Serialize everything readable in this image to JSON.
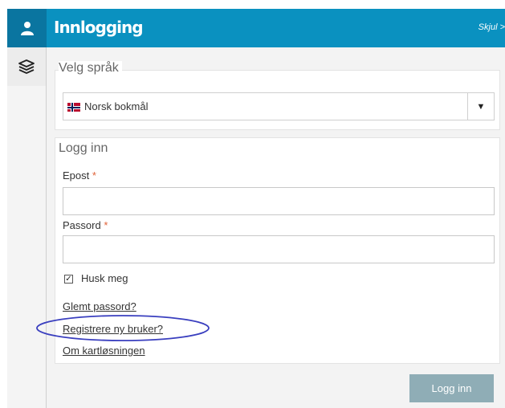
{
  "sidebar": {
    "user_icon": "user-icon",
    "layers_icon": "layers-icon"
  },
  "header": {
    "title": "Innlogging",
    "hide_label": "Skjul >"
  },
  "language": {
    "legend": "Velg språk",
    "selected": "Norsk bokmål",
    "arrow": "▼"
  },
  "login": {
    "legend": "Logg inn",
    "email_label": "Epost",
    "email_value": "",
    "password_label": "Passord",
    "password_value": "",
    "required_mark": "*",
    "remember_label": "Husk meg",
    "remember_checked": true,
    "check_mark": "✓",
    "forgot_link": "Glemt passord?",
    "register_link": "Registrere ny bruker?",
    "about_link": "Om kartløsningen",
    "submit_label": "Logg inn"
  },
  "colors": {
    "header_bg": "#0a91c0",
    "sidebar_active_bg": "#0a75a0",
    "button_bg": "#8fadb6",
    "required": "#e0633a",
    "annotation": "#3a3fbf"
  }
}
